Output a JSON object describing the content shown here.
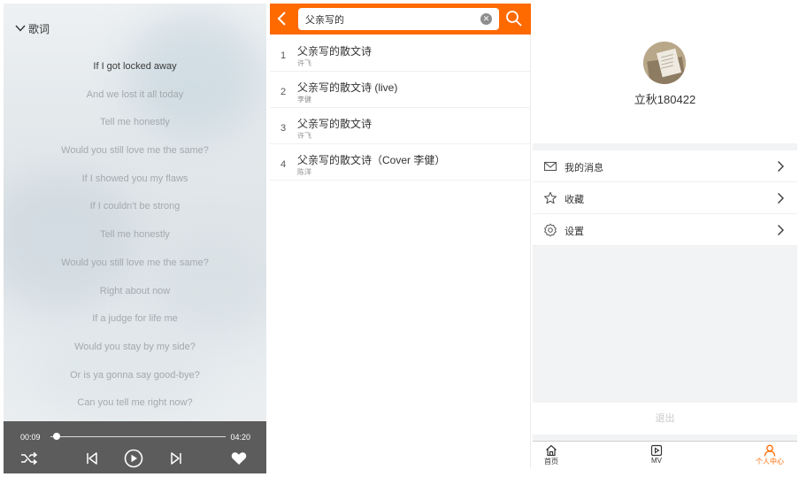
{
  "colors": {
    "accent": "#ff6a00",
    "player_bar": "#5c5c5c"
  },
  "player": {
    "lyrics_toggle_label": "歌词",
    "lyrics": [
      "If I got locked away",
      "And we lost it all today",
      "Tell me honestly",
      "Would you still love me the same?",
      "If I showed you my flaws",
      "If I couldn't be strong",
      "Tell me honestly",
      "Would you still love me the same?",
      "Right about now",
      "If a judge for life me",
      "Would you stay by my side?",
      "Or is ya gonna say good-bye?",
      "Can you tell me right now?"
    ],
    "active_lyric_index": 0,
    "current_time": "00:09",
    "total_time": "04:20",
    "progress_fraction": 0.035,
    "controls": [
      "shuffle-icon",
      "previous-icon",
      "play-icon",
      "next-icon",
      "heart-icon"
    ]
  },
  "search": {
    "query": "父亲写的",
    "results": [
      {
        "index": "1",
        "title": "父亲写的散文诗",
        "artist": "许飞"
      },
      {
        "index": "2",
        "title": "父亲写的散文诗 (live)",
        "artist": "李健"
      },
      {
        "index": "3",
        "title": "父亲写的散文诗",
        "artist": "许飞"
      },
      {
        "index": "4",
        "title": "父亲写的散文诗（Cover 李健）",
        "artist": "陈洋"
      }
    ]
  },
  "user": {
    "username": "立秋180422",
    "menu": [
      {
        "label": "我的消息",
        "icon": "mail-icon"
      },
      {
        "label": "收藏",
        "icon": "star-icon"
      },
      {
        "label": "设置",
        "icon": "gear-icon"
      }
    ],
    "logout_label": "退出",
    "tabs": [
      {
        "label": "首页",
        "icon": "home-icon"
      },
      {
        "label": "MV",
        "icon": "video-icon"
      },
      {
        "label": "个人中心",
        "icon": "person-icon",
        "active": true
      }
    ]
  }
}
